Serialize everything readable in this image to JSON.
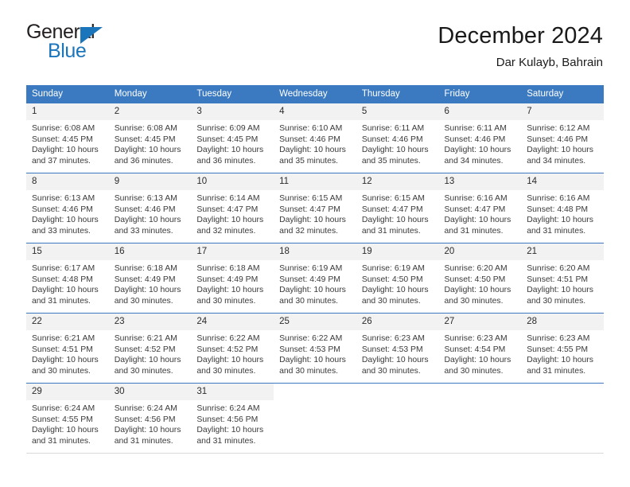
{
  "brand": {
    "name_part1": "General",
    "name_part2": "Blue",
    "accent_color": "#1b75bb"
  },
  "header": {
    "title": "December 2024",
    "subtitle": "Dar Kulayb, Bahrain",
    "header_bg_color": "#3b7ac0",
    "header_text_color": "#ffffff"
  },
  "weekdays": [
    "Sunday",
    "Monday",
    "Tuesday",
    "Wednesday",
    "Thursday",
    "Friday",
    "Saturday"
  ],
  "weeks": [
    [
      {
        "day": "1",
        "sunrise": "Sunrise: 6:08 AM",
        "sunset": "Sunset: 4:45 PM",
        "daylight": "Daylight: 10 hours and 37 minutes."
      },
      {
        "day": "2",
        "sunrise": "Sunrise: 6:08 AM",
        "sunset": "Sunset: 4:45 PM",
        "daylight": "Daylight: 10 hours and 36 minutes."
      },
      {
        "day": "3",
        "sunrise": "Sunrise: 6:09 AM",
        "sunset": "Sunset: 4:45 PM",
        "daylight": "Daylight: 10 hours and 36 minutes."
      },
      {
        "day": "4",
        "sunrise": "Sunrise: 6:10 AM",
        "sunset": "Sunset: 4:46 PM",
        "daylight": "Daylight: 10 hours and 35 minutes."
      },
      {
        "day": "5",
        "sunrise": "Sunrise: 6:11 AM",
        "sunset": "Sunset: 4:46 PM",
        "daylight": "Daylight: 10 hours and 35 minutes."
      },
      {
        "day": "6",
        "sunrise": "Sunrise: 6:11 AM",
        "sunset": "Sunset: 4:46 PM",
        "daylight": "Daylight: 10 hours and 34 minutes."
      },
      {
        "day": "7",
        "sunrise": "Sunrise: 6:12 AM",
        "sunset": "Sunset: 4:46 PM",
        "daylight": "Daylight: 10 hours and 34 minutes."
      }
    ],
    [
      {
        "day": "8",
        "sunrise": "Sunrise: 6:13 AM",
        "sunset": "Sunset: 4:46 PM",
        "daylight": "Daylight: 10 hours and 33 minutes."
      },
      {
        "day": "9",
        "sunrise": "Sunrise: 6:13 AM",
        "sunset": "Sunset: 4:46 PM",
        "daylight": "Daylight: 10 hours and 33 minutes."
      },
      {
        "day": "10",
        "sunrise": "Sunrise: 6:14 AM",
        "sunset": "Sunset: 4:47 PM",
        "daylight": "Daylight: 10 hours and 32 minutes."
      },
      {
        "day": "11",
        "sunrise": "Sunrise: 6:15 AM",
        "sunset": "Sunset: 4:47 PM",
        "daylight": "Daylight: 10 hours and 32 minutes."
      },
      {
        "day": "12",
        "sunrise": "Sunrise: 6:15 AM",
        "sunset": "Sunset: 4:47 PM",
        "daylight": "Daylight: 10 hours and 31 minutes."
      },
      {
        "day": "13",
        "sunrise": "Sunrise: 6:16 AM",
        "sunset": "Sunset: 4:47 PM",
        "daylight": "Daylight: 10 hours and 31 minutes."
      },
      {
        "day": "14",
        "sunrise": "Sunrise: 6:16 AM",
        "sunset": "Sunset: 4:48 PM",
        "daylight": "Daylight: 10 hours and 31 minutes."
      }
    ],
    [
      {
        "day": "15",
        "sunrise": "Sunrise: 6:17 AM",
        "sunset": "Sunset: 4:48 PM",
        "daylight": "Daylight: 10 hours and 31 minutes."
      },
      {
        "day": "16",
        "sunrise": "Sunrise: 6:18 AM",
        "sunset": "Sunset: 4:49 PM",
        "daylight": "Daylight: 10 hours and 30 minutes."
      },
      {
        "day": "17",
        "sunrise": "Sunrise: 6:18 AM",
        "sunset": "Sunset: 4:49 PM",
        "daylight": "Daylight: 10 hours and 30 minutes."
      },
      {
        "day": "18",
        "sunrise": "Sunrise: 6:19 AM",
        "sunset": "Sunset: 4:49 PM",
        "daylight": "Daylight: 10 hours and 30 minutes."
      },
      {
        "day": "19",
        "sunrise": "Sunrise: 6:19 AM",
        "sunset": "Sunset: 4:50 PM",
        "daylight": "Daylight: 10 hours and 30 minutes."
      },
      {
        "day": "20",
        "sunrise": "Sunrise: 6:20 AM",
        "sunset": "Sunset: 4:50 PM",
        "daylight": "Daylight: 10 hours and 30 minutes."
      },
      {
        "day": "21",
        "sunrise": "Sunrise: 6:20 AM",
        "sunset": "Sunset: 4:51 PM",
        "daylight": "Daylight: 10 hours and 30 minutes."
      }
    ],
    [
      {
        "day": "22",
        "sunrise": "Sunrise: 6:21 AM",
        "sunset": "Sunset: 4:51 PM",
        "daylight": "Daylight: 10 hours and 30 minutes."
      },
      {
        "day": "23",
        "sunrise": "Sunrise: 6:21 AM",
        "sunset": "Sunset: 4:52 PM",
        "daylight": "Daylight: 10 hours and 30 minutes."
      },
      {
        "day": "24",
        "sunrise": "Sunrise: 6:22 AM",
        "sunset": "Sunset: 4:52 PM",
        "daylight": "Daylight: 10 hours and 30 minutes."
      },
      {
        "day": "25",
        "sunrise": "Sunrise: 6:22 AM",
        "sunset": "Sunset: 4:53 PM",
        "daylight": "Daylight: 10 hours and 30 minutes."
      },
      {
        "day": "26",
        "sunrise": "Sunrise: 6:23 AM",
        "sunset": "Sunset: 4:53 PM",
        "daylight": "Daylight: 10 hours and 30 minutes."
      },
      {
        "day": "27",
        "sunrise": "Sunrise: 6:23 AM",
        "sunset": "Sunset: 4:54 PM",
        "daylight": "Daylight: 10 hours and 30 minutes."
      },
      {
        "day": "28",
        "sunrise": "Sunrise: 6:23 AM",
        "sunset": "Sunset: 4:55 PM",
        "daylight": "Daylight: 10 hours and 31 minutes."
      }
    ],
    [
      {
        "day": "29",
        "sunrise": "Sunrise: 6:24 AM",
        "sunset": "Sunset: 4:55 PM",
        "daylight": "Daylight: 10 hours and 31 minutes."
      },
      {
        "day": "30",
        "sunrise": "Sunrise: 6:24 AM",
        "sunset": "Sunset: 4:56 PM",
        "daylight": "Daylight: 10 hours and 31 minutes."
      },
      {
        "day": "31",
        "sunrise": "Sunrise: 6:24 AM",
        "sunset": "Sunset: 4:56 PM",
        "daylight": "Daylight: 10 hours and 31 minutes."
      },
      {
        "day": "",
        "sunrise": "",
        "sunset": "",
        "daylight": ""
      },
      {
        "day": "",
        "sunrise": "",
        "sunset": "",
        "daylight": ""
      },
      {
        "day": "",
        "sunrise": "",
        "sunset": "",
        "daylight": ""
      },
      {
        "day": "",
        "sunrise": "",
        "sunset": "",
        "daylight": ""
      }
    ]
  ]
}
